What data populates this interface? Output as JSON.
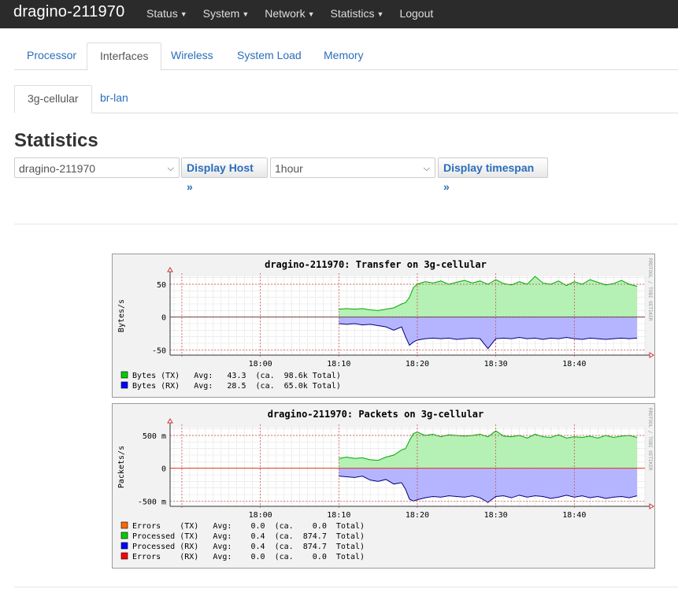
{
  "header": {
    "brand": "dragino-211970",
    "menu": [
      "Status",
      "System",
      "Network",
      "Statistics",
      "Logout"
    ]
  },
  "tabs_primary": [
    "Processor",
    "Interfaces",
    "Wireless",
    "System Load",
    "Memory"
  ],
  "tabs_primary_active": "Interfaces",
  "tabs_secondary": [
    "3g-cellular",
    "br-lan"
  ],
  "tabs_secondary_active": "3g-cellular",
  "page_title": "Statistics",
  "controls": {
    "host_value": "dragino-211970",
    "host_button": "Display Host »",
    "timespan_value": "1hour",
    "timespan_button": "Display timespan »"
  },
  "rrd_credit": "RRDTOOL / TOBI OETIKER",
  "chart_data": [
    {
      "type": "area",
      "title": "dragino-211970: Transfer on 3g-cellular",
      "ylabel": "Bytes/s",
      "ytick_labels": [
        "50",
        "0",
        "-50"
      ],
      "ytick_values": [
        50,
        0,
        -50
      ],
      "ylim": [
        -58,
        62
      ],
      "xtick_labels": [
        "18:00",
        "18:10",
        "18:20",
        "18:30",
        "18:40"
      ],
      "xtick_minutes": [
        0,
        10,
        20,
        30,
        40
      ],
      "xlim_minutes": [
        -11.5,
        49
      ],
      "grid": true,
      "series": [
        {
          "name": "Bytes (TX)",
          "color": "#00cc00",
          "fill": "#b5f0b5",
          "x_minutes": [
            10.0,
            11.0,
            12.0,
            13.0,
            14.0,
            15.0,
            16.0,
            17.0,
            18.0,
            18.5,
            19.0,
            19.5,
            20.0,
            21.0,
            22.0,
            23.0,
            24.0,
            25.0,
            26.0,
            27.0,
            28.0,
            29.0,
            30.0,
            31.0,
            32.0,
            33.0,
            34.0,
            35.0,
            36.0,
            37.0,
            38.0,
            39.0,
            40.0,
            41.0,
            42.0,
            43.0,
            44.0,
            45.0,
            46.0,
            47.0,
            48.0
          ],
          "values": [
            12,
            13,
            12,
            13,
            11,
            10,
            12,
            14,
            20,
            22,
            30,
            45,
            50,
            54,
            52,
            55,
            50,
            53,
            56,
            52,
            55,
            50,
            57,
            51,
            49,
            54,
            50,
            62,
            52,
            50,
            55,
            48,
            54,
            50,
            57,
            53,
            49,
            51,
            56,
            50,
            47
          ],
          "legend_avg": "43.3",
          "legend_total": "98.6k"
        },
        {
          "name": "Bytes (RX)",
          "color": "#0000ff",
          "fill": "#b5b5ff",
          "x_minutes": [
            10.0,
            11.0,
            12.0,
            13.0,
            14.0,
            15.0,
            16.0,
            17.0,
            18.0,
            18.5,
            19.0,
            19.5,
            20.0,
            21.0,
            22.0,
            23.0,
            24.0,
            25.0,
            26.0,
            27.0,
            28.0,
            29.0,
            30.0,
            31.0,
            32.0,
            33.0,
            34.0,
            35.0,
            36.0,
            37.0,
            38.0,
            39.0,
            40.0,
            41.0,
            42.0,
            43.0,
            44.0,
            45.0,
            46.0,
            47.0,
            48.0
          ],
          "values": [
            -10,
            -11,
            -10,
            -12,
            -11,
            -13,
            -15,
            -20,
            -15,
            -30,
            -43,
            -38,
            -35,
            -33,
            -32,
            -33,
            -32,
            -34,
            -33,
            -32,
            -33,
            -48,
            -33,
            -32,
            -33,
            -31,
            -33,
            -32,
            -34,
            -32,
            -33,
            -31,
            -33,
            -34,
            -32,
            -33,
            -34,
            -33,
            -32,
            -33,
            -32
          ],
          "legend_avg": "28.5",
          "legend_total": "65.0k"
        }
      ],
      "legend": [
        {
          "label": "Bytes (TX)",
          "color": "#00cc00",
          "text": "Bytes (TX)   Avg:   43.3  (ca.  98.6k Total)"
        },
        {
          "label": "Bytes (RX)",
          "color": "#0000ff",
          "text": "Bytes (RX)   Avg:   28.5  (ca.  65.0k Total)"
        }
      ]
    },
    {
      "type": "area",
      "title": "dragino-211970: Packets on 3g-cellular",
      "ylabel": "Packets/s",
      "ytick_labels": [
        "500 m",
        "0",
        "-500 m"
      ],
      "ytick_values": [
        0.5,
        0,
        -0.5
      ],
      "ylim": [
        -0.58,
        0.62
      ],
      "xtick_labels": [
        "18:00",
        "18:10",
        "18:20",
        "18:30",
        "18:40"
      ],
      "xtick_minutes": [
        0,
        10,
        20,
        30,
        40
      ],
      "xlim_minutes": [
        -11.5,
        49
      ],
      "grid": true,
      "series": [
        {
          "name": "Processed (TX)",
          "color": "#00cc00",
          "fill": "#b5f0b5",
          "x_minutes": [
            10.0,
            11.0,
            12.0,
            13.0,
            14.0,
            15.0,
            16.0,
            17.0,
            18.0,
            18.5,
            19.0,
            19.5,
            20.0,
            21.0,
            22.0,
            23.0,
            24.0,
            25.0,
            26.0,
            27.0,
            28.0,
            29.0,
            30.0,
            31.0,
            32.0,
            33.0,
            34.0,
            35.0,
            36.0,
            37.0,
            38.0,
            39.0,
            40.0,
            41.0,
            42.0,
            43.0,
            44.0,
            45.0,
            46.0,
            47.0,
            48.0
          ],
          "values": [
            0.15,
            0.17,
            0.15,
            0.16,
            0.13,
            0.12,
            0.17,
            0.2,
            0.28,
            0.3,
            0.42,
            0.53,
            0.55,
            0.5,
            0.52,
            0.48,
            0.51,
            0.5,
            0.49,
            0.5,
            0.52,
            0.48,
            0.57,
            0.49,
            0.48,
            0.5,
            0.46,
            0.52,
            0.48,
            0.47,
            0.51,
            0.46,
            0.48,
            0.47,
            0.49,
            0.46,
            0.5,
            0.47,
            0.49,
            0.5,
            0.47
          ],
          "legend_avg": "0.4",
          "legend_total": "874.7"
        },
        {
          "name": "Processed (RX)",
          "color": "#0000ff",
          "fill": "#b5b5ff",
          "x_minutes": [
            10.0,
            11.0,
            12.0,
            13.0,
            14.0,
            15.0,
            16.0,
            17.0,
            18.0,
            18.5,
            19.0,
            19.5,
            20.0,
            21.0,
            22.0,
            23.0,
            24.0,
            25.0,
            26.0,
            27.0,
            28.0,
            29.0,
            30.0,
            31.0,
            32.0,
            33.0,
            34.0,
            35.0,
            36.0,
            37.0,
            38.0,
            39.0,
            40.0,
            41.0,
            42.0,
            43.0,
            44.0,
            45.0,
            46.0,
            47.0,
            48.0
          ],
          "values": [
            -0.12,
            -0.13,
            -0.14,
            -0.12,
            -0.18,
            -0.2,
            -0.17,
            -0.24,
            -0.22,
            -0.32,
            -0.47,
            -0.5,
            -0.48,
            -0.45,
            -0.43,
            -0.44,
            -0.42,
            -0.43,
            -0.44,
            -0.42,
            -0.45,
            -0.52,
            -0.43,
            -0.42,
            -0.45,
            -0.41,
            -0.44,
            -0.42,
            -0.43,
            -0.46,
            -0.44,
            -0.41,
            -0.44,
            -0.42,
            -0.45,
            -0.43,
            -0.46,
            -0.44,
            -0.43,
            -0.45,
            -0.42
          ],
          "legend_avg": "0.4",
          "legend_total": "874.7"
        },
        {
          "name": "Errors (TX)",
          "color": "#ff6600",
          "values": [
            0
          ],
          "legend_avg": "0.0",
          "legend_total": "0.0"
        },
        {
          "name": "Errors (RX)",
          "color": "#ff0000",
          "values": [
            0
          ],
          "legend_avg": "0.0",
          "legend_total": "0.0"
        }
      ],
      "legend": [
        {
          "label": "Errors (TX)",
          "color": "#ff6600",
          "text": "Errors    (TX)   Avg:    0.0  (ca.    0.0  Total)"
        },
        {
          "label": "Processed (TX)",
          "color": "#00cc00",
          "text": "Processed (TX)   Avg:    0.4  (ca.  874.7  Total)"
        },
        {
          "label": "Processed (RX)",
          "color": "#0000ff",
          "text": "Processed (RX)   Avg:    0.4  (ca.  874.7  Total)"
        },
        {
          "label": "Errors (RX)",
          "color": "#ff0000",
          "text": "Errors    (RX)   Avg:    0.0  (ca.    0.0  Total)"
        }
      ]
    }
  ]
}
